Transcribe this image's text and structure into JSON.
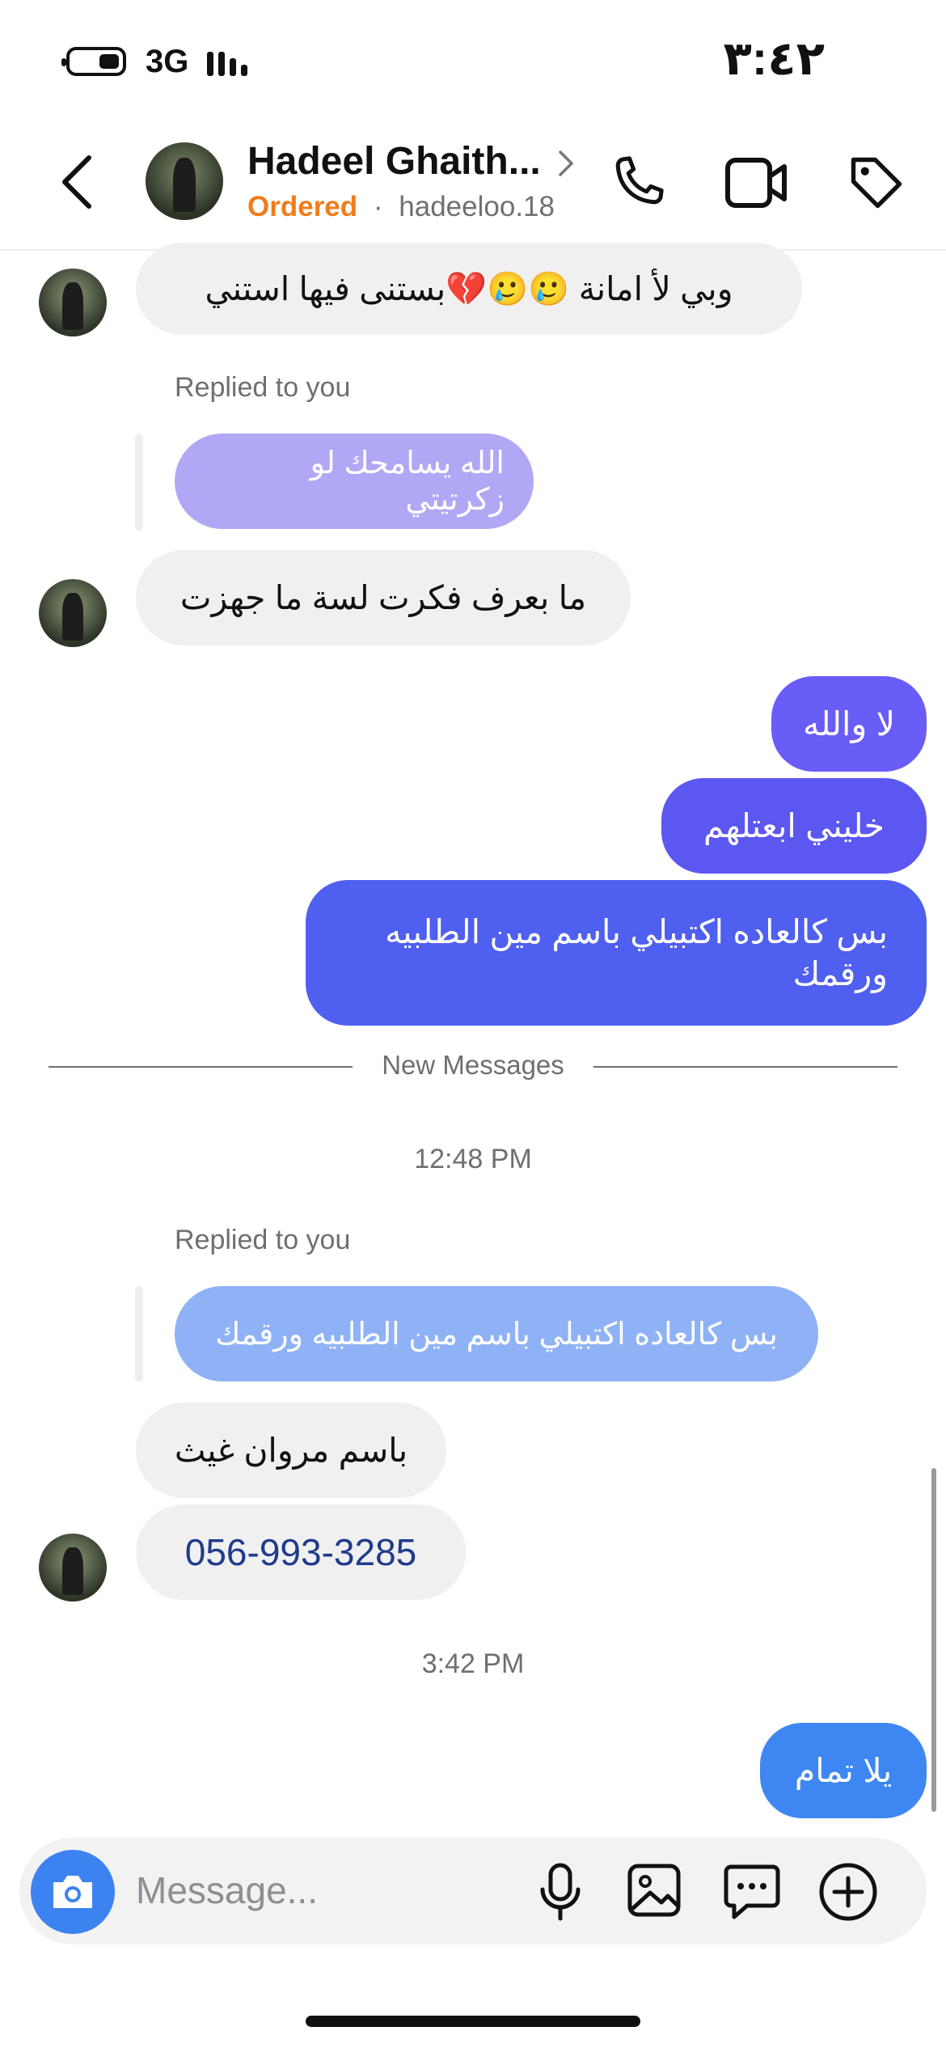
{
  "status_bar": {
    "time": "٣:٤٢",
    "network": "3G"
  },
  "header": {
    "name": "Hadeel Ghaith...",
    "status": "Ordered",
    "separator": "·",
    "handle": "hadeeloo.18"
  },
  "messages": {
    "m1": "وبي لأ امانة 🥲🥲💔بستنى فيها استني",
    "replied_1": "Replied to you",
    "quote_1": "الله يسامحك لو زكرتيتي",
    "m2": "ما بعرف فكرت لسة ما جهزت",
    "m3": "لا والله",
    "m4": "خليني ابعتلهم",
    "m5": "بس كالعاده اكتبيلي باسم مين الطلبيه ورقمك",
    "new_messages": "New Messages",
    "time_1": "12:48 PM",
    "replied_2": "Replied to you",
    "quote_2": "بس كالعاده اكتبيلي باسم مين الطلبيه ورقمك",
    "m6": "باسم مروان غيث",
    "m7": "056-993-3285",
    "time_2": "3:42 PM",
    "m8": "يلا تمام"
  },
  "composer": {
    "placeholder": "Message..."
  },
  "colors": {
    "accent_blue": "#3c82f0",
    "ordered_orange": "#f07c1b",
    "out_purple_1": "#6a5cf6",
    "out_purple_2": "#5b57f0",
    "out_indigo": "#4f5fef",
    "out_blue": "#3e87f2",
    "quote_lavender": "#b0a8f5",
    "quote_blue": "#8fb2f7",
    "phone_link": "#1f3b8a"
  },
  "icons": [
    "back-arrow-icon",
    "chevron-right-icon",
    "phone-icon",
    "video-icon",
    "tag-icon",
    "camera-icon",
    "microphone-icon",
    "image-icon",
    "sticker-icon",
    "plus-icon"
  ]
}
